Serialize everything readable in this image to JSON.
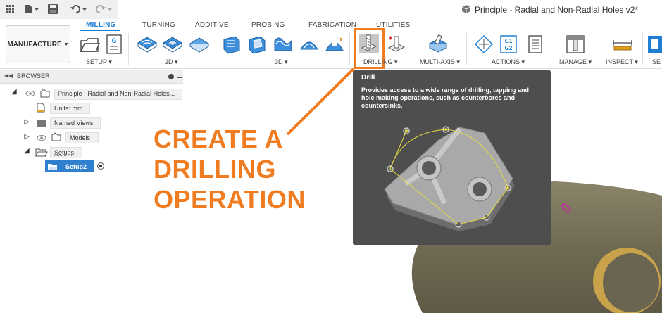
{
  "window": {
    "document_title": "Principle - Radial and Non-Radial Holes v2*"
  },
  "toolbar": {
    "workspace_label": "MANUFACTURE",
    "tabs": [
      "MILLING",
      "TURNING",
      "ADDITIVE",
      "PROBING",
      "FABRICATION",
      "UTILITIES"
    ],
    "active_tab": "MILLING",
    "groups": [
      "SETUP",
      "2D",
      "3D",
      "DRILLING",
      "MULTI-AXIS",
      "ACTIONS",
      "MANAGE",
      "INSPECT",
      "SE"
    ],
    "actions_g1g2": "G1 G2"
  },
  "browser": {
    "title": "BROWSER",
    "root": "Principle - Radial and Non-Radial Holes...",
    "items": [
      "Units: mm",
      "Named Views",
      "Models",
      "Setups"
    ],
    "setup_item": "Setup2"
  },
  "annotation": {
    "lines": [
      "CREATE A",
      "DRILLING",
      "OPERATION"
    ],
    "color": "#f07c22"
  },
  "tooltip": {
    "title": "Drill",
    "description": "Provides access to a wide range of drilling, tapping and hole making operations, such as counterbores and countersinks."
  },
  "colors": {
    "accent": "#1e7ed2",
    "highlight": "#f07c22",
    "tooltip_bg": "#4e4e4e",
    "model": "#77705a"
  }
}
